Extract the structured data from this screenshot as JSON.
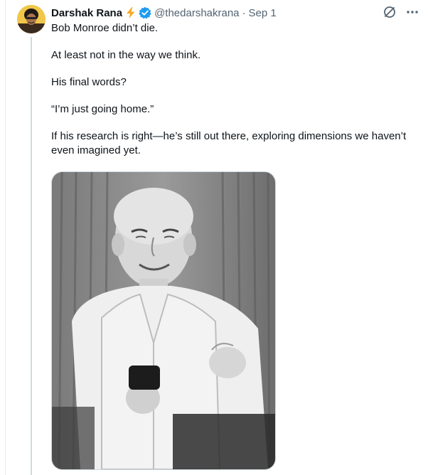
{
  "author": {
    "name": "Darshak Rana",
    "handle": "@thedarshakrana",
    "date": "Sep 1",
    "separator": "·"
  },
  "tweet": {
    "lines": [
      "Bob Monroe didn’t die.",
      "At least not in the way we think.",
      "His final words?",
      "“I’m just going home.”",
      "If his research is right—he’s still out there, exploring dimensions we haven’t even imagined yet."
    ]
  },
  "icons": {
    "bolt": "lightning-bolt-icon",
    "verified": "verified-badge-icon",
    "grok": "grok-icon",
    "more": "more-icon"
  },
  "colors": {
    "bolt": "#f9a825",
    "verified": "#1d9bf0",
    "secondary_text": "#536471",
    "thread_line": "#cfd9de"
  }
}
